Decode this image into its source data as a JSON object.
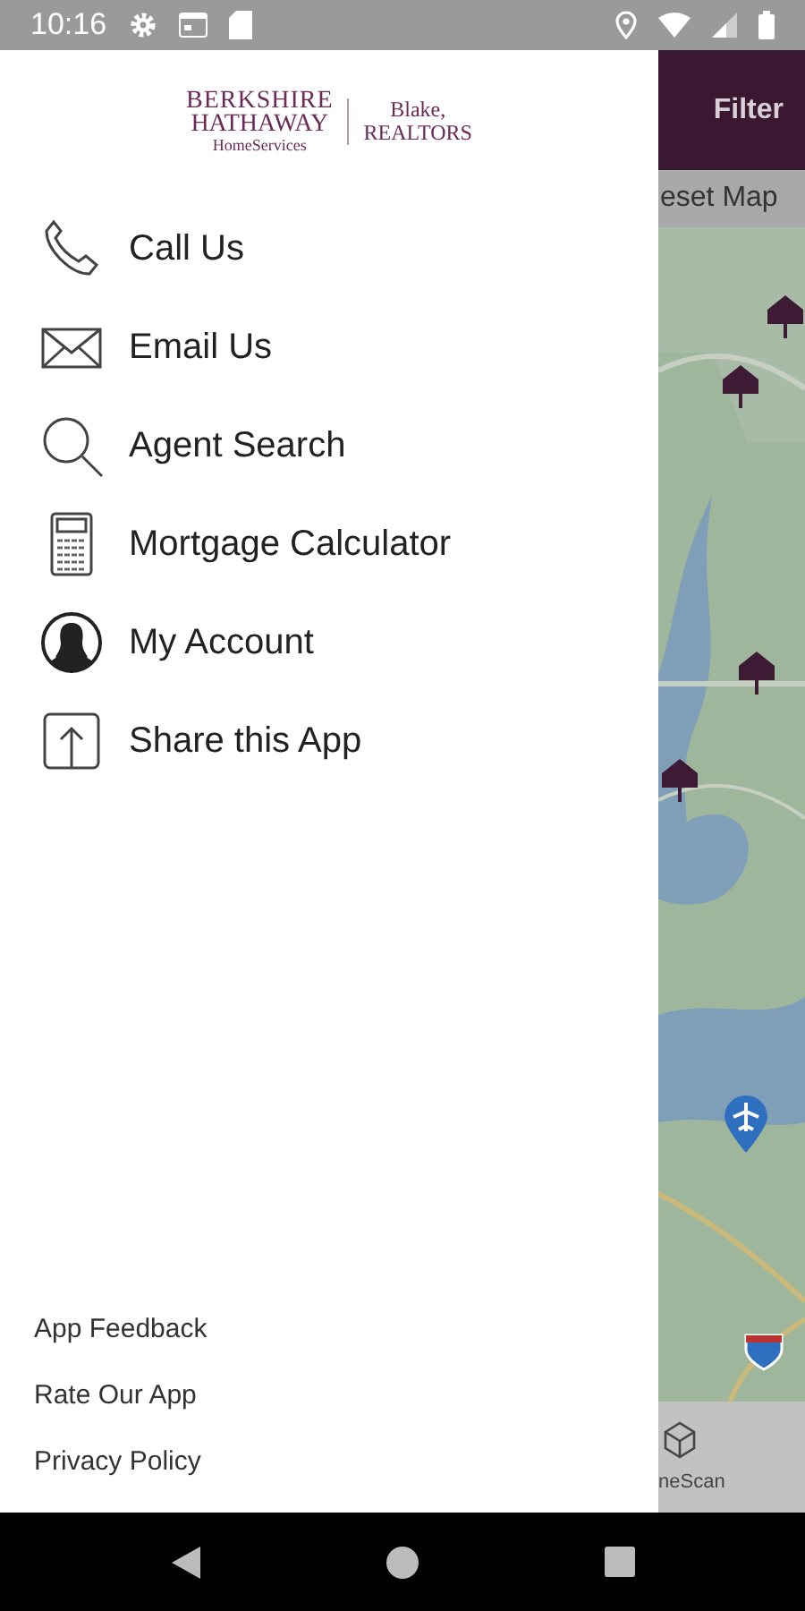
{
  "status_bar": {
    "time": "10:16"
  },
  "logo": {
    "line_1": "BERKSHIRE",
    "line_2": "HATHAWAY",
    "line_3": "HomeServices",
    "office_1": "Blake,",
    "office_2": "REALTORS"
  },
  "menu": [
    {
      "kind": "phone",
      "label": "Call Us"
    },
    {
      "kind": "mail",
      "label": "Email Us"
    },
    {
      "kind": "search",
      "label": "Agent Search"
    },
    {
      "kind": "calculator",
      "label": "Mortgage Calculator"
    },
    {
      "kind": "account",
      "label": "My Account"
    },
    {
      "kind": "share",
      "label": "Share this App"
    }
  ],
  "footer_links": [
    "App Feedback",
    "Rate Our App",
    "Privacy Policy"
  ],
  "background_app": {
    "filter_button": "Filter",
    "reset_button": "eset Map",
    "bottom_tab": "neScan"
  }
}
